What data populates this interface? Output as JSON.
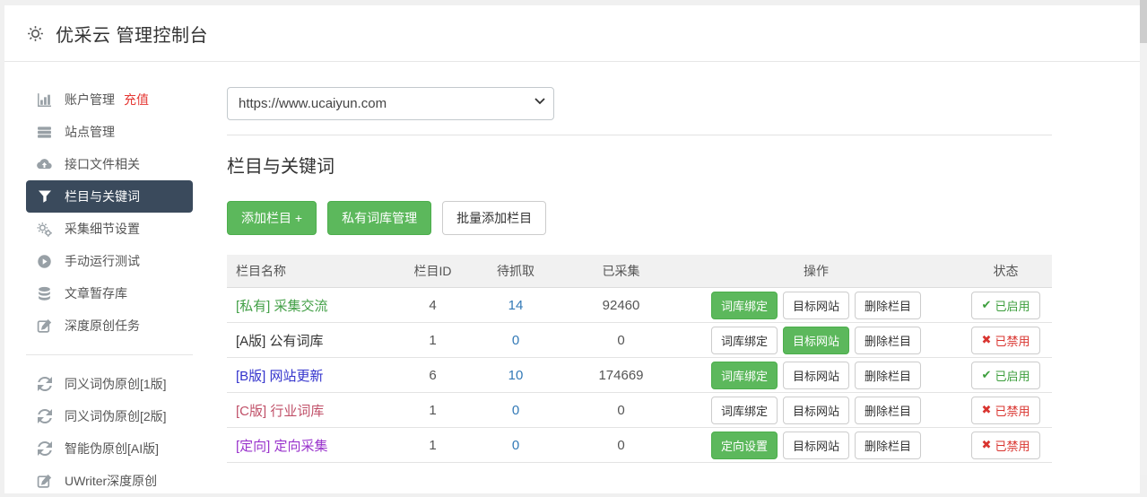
{
  "header": {
    "title": "优采云 管理控制台"
  },
  "sidebar": {
    "items": [
      {
        "label": "账户管理",
        "badge": "充值"
      },
      {
        "label": "站点管理"
      },
      {
        "label": "接口文件相关"
      },
      {
        "label": "栏目与关键词"
      },
      {
        "label": "采集细节设置"
      },
      {
        "label": "手动运行测试"
      },
      {
        "label": "文章暂存库"
      },
      {
        "label": "深度原创任务"
      },
      {
        "label": "同义词伪原创[1版]"
      },
      {
        "label": "同义词伪原创[2版]"
      },
      {
        "label": "智能伪原创[AI版]"
      },
      {
        "label": "UWriter深度原创"
      }
    ]
  },
  "main": {
    "site_selector": {
      "selected": "https://www.ucaiyun.com"
    },
    "section_title": "栏目与关键词",
    "toolbar": {
      "add_column": "添加栏目 +",
      "private_thesaurus": "私有词库管理",
      "batch_add": "批量添加栏目"
    },
    "table": {
      "headers": [
        "栏目名称",
        "栏目ID",
        "待抓取",
        "已采集",
        "操作",
        "状态"
      ],
      "rows": [
        {
          "name": "[私有] 采集交流",
          "name_color": "#43a047",
          "id": "4",
          "pending": "14",
          "collected": "92460",
          "actions": [
            "词库绑定",
            "目标网站",
            "删除栏目"
          ],
          "status": {
            "label": "已启用",
            "icon": "✔"
          }
        },
        {
          "name": "[A版] 公有词库",
          "name_color": "#333333",
          "id": "1",
          "pending": "0",
          "collected": "0",
          "actions": [
            "词库绑定",
            "目标网站",
            "删除栏目"
          ],
          "status": {
            "label": "已禁用",
            "icon": "✖"
          }
        },
        {
          "name": "[B版] 网站更新",
          "name_color": "#3333cc",
          "id": "6",
          "pending": "10",
          "collected": "174669",
          "actions": [
            "词库绑定",
            "目标网站",
            "删除栏目"
          ],
          "status": {
            "label": "已启用",
            "icon": "✔"
          }
        },
        {
          "name": "[C版] 行业词库",
          "name_color": "#c05068",
          "id": "1",
          "pending": "0",
          "collected": "0",
          "actions": [
            "词库绑定",
            "目标网站",
            "删除栏目"
          ],
          "status": {
            "label": "已禁用",
            "icon": "✖"
          }
        },
        {
          "name": "[定向] 定向采集",
          "name_color": "#9933cc",
          "id": "1",
          "pending": "0",
          "collected": "0",
          "actions": [
            "定向设置",
            "目标网站",
            "删除栏目"
          ],
          "status": {
            "label": "已禁用",
            "icon": "✖"
          }
        }
      ]
    }
  },
  "colors": {
    "accent_green": "#5cb85c",
    "sidebar_active": "#3a4a5c",
    "link_blue": "#337ab7",
    "enabled_green": "#3c9e3c",
    "disabled_red": "#d9342f",
    "recharge_red": "#e53935"
  }
}
